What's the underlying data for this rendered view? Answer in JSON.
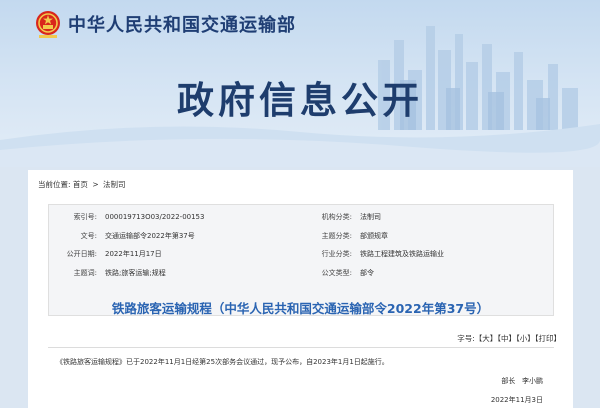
{
  "header": {
    "site_title": "中华人民共和国交通运输部",
    "page_title": "政府信息公开"
  },
  "breadcrumb": {
    "prefix": "当前位置:",
    "items": [
      "首页",
      "法制司"
    ],
    "separator": ">"
  },
  "info": {
    "index_label": "索引号:",
    "index_value": "000019713O03/2022-00153",
    "org_label": "机构分类:",
    "org_value": "法制司",
    "docno_label": "文号:",
    "docno_value": "交通运输部令2022年第37号",
    "topic_label": "主题分类:",
    "topic_value": "部颁规章",
    "pubdate_label": "公开日期:",
    "pubdate_value": "2022年11月17日",
    "industry_label": "行业分类:",
    "industry_value": "铁路工程建筑及铁路运输业",
    "keyword_label": "主题词:",
    "keyword_value": "铁路;旅客运输;规程",
    "doctype_label": "公文类型:",
    "doctype_value": "部令"
  },
  "document": {
    "title": "铁路旅客运输规程（中华人民共和国交通运输部令2022年第37号）",
    "font_size_label": "字号:",
    "font_sizes": [
      "【大】",
      "【中】",
      "【小】"
    ],
    "print_label": "【打印】",
    "body": "《铁路旅客运输规程》已于2022年11月1日经第25次部务会议通过，现予公布，自2023年1月1日起施行。",
    "signer_title": "部长",
    "signer_name": "李小鹏",
    "sign_date": "2022年11月3日"
  }
}
